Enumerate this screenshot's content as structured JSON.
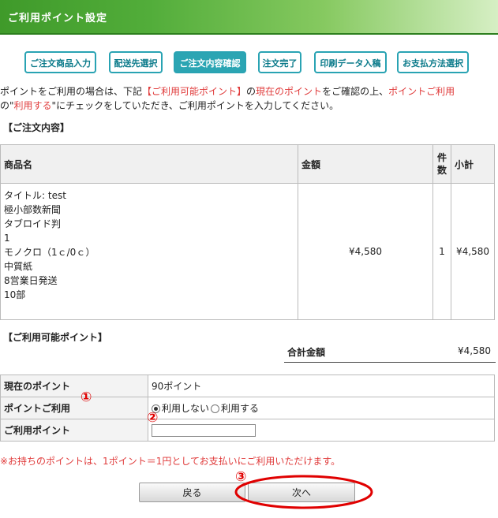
{
  "header": {
    "title": "ご利用ポイント設定"
  },
  "steps": [
    "ご注文商品入力",
    "配送先選択",
    "ご注文内容確認",
    "注文完了",
    "印刷データ入稿",
    "お支払方法選択"
  ],
  "intro": {
    "line1_a": "ポイントをご利用の場合は、下記",
    "line1_b": "【ご利用可能ポイント】",
    "line1_c": "の",
    "line1_d": "現在のポイント",
    "line1_e": "をご確認の上、",
    "line1_f": "ポイントご利用",
    "line2_a": "の\"",
    "line2_b": "利用する",
    "line2_c": "\"にチェックをしていただき、ご利用ポイントを入力してください。"
  },
  "order_section": {
    "title": "【ご注文内容】"
  },
  "order_table": {
    "headers": {
      "name": "商品名",
      "price": "金額",
      "qty": "件数",
      "subtotal": "小計"
    },
    "item_lines": [
      "タイトル: test",
      "極小部数新聞",
      "タブロイド判",
      "1",
      "モノクロ（1ｃ/0ｃ）",
      "中質紙",
      "8営業日発送",
      "10部"
    ],
    "price": "¥4,580",
    "qty": "1",
    "subtotal": "¥4,580"
  },
  "points_section": {
    "title": "【ご利用可能ポイント】"
  },
  "total": {
    "label": "合計金額",
    "value": "¥4,580"
  },
  "points_table": {
    "current_label": "現在のポイント",
    "current_value": "90ポイント",
    "use_label": "ポイントご利用",
    "option_no": "利用しない",
    "option_yes": "利用する",
    "amount_label": "ご利用ポイント",
    "amount_value": ""
  },
  "note": "※お持ちのポイントは、1ポイント＝1円としてお支払いにご利用いただけます。",
  "buttons": {
    "back": "戻る",
    "next": "次へ"
  },
  "annotations": {
    "a1": "①",
    "a2": "②",
    "a3": "③"
  },
  "colors": {
    "accent": "#2ba5b3",
    "header_green": "#52ad3a",
    "warning_red": "#e03c3c",
    "annotation_red": "#e00000"
  }
}
